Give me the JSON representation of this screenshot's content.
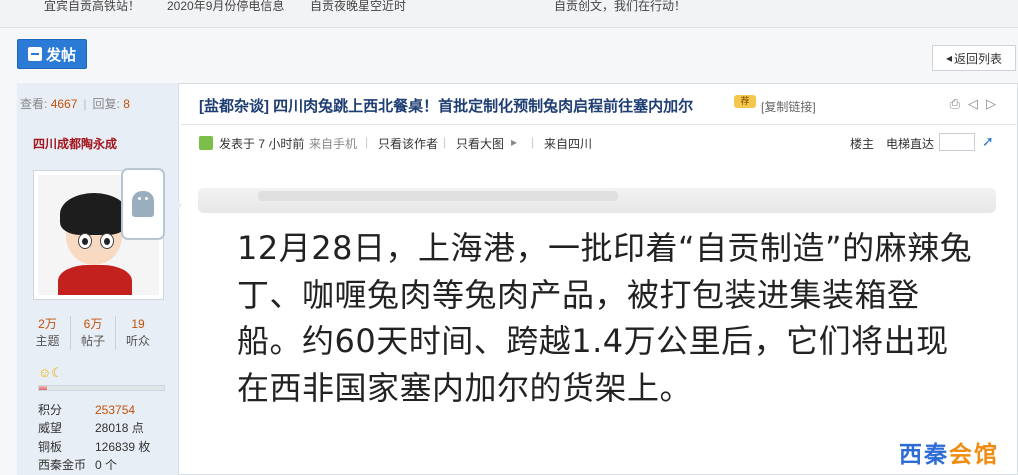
{
  "topbar": {
    "items": [
      "宜宾自贡高铁站！",
      "2020年9月份停电信息",
      "自贡夜晚星空近时",
      "自贡创文，我们在行动！"
    ]
  },
  "toolbar": {
    "post_label": "发帖",
    "back_label": "返回列表"
  },
  "thread_stats": {
    "views_label": "查看:",
    "views": "4667",
    "replies_label": "回复:",
    "replies": "8"
  },
  "thread": {
    "title": "[盐都杂谈] 四川肉兔跳上西北餐桌！首批定制化预制兔肉启程前往塞内加尔",
    "copy_link": "[复制链接]"
  },
  "author": {
    "name": "四川成都陶永成",
    "counts": [
      {
        "value": "2万",
        "label": "主题"
      },
      {
        "value": "6万",
        "label": "帖子"
      },
      {
        "value": "19",
        "label": "听众"
      }
    ],
    "level_progress": 0.06,
    "attributes": [
      {
        "label": "积分",
        "value": "253754",
        "highlight": true
      },
      {
        "label": "威望",
        "value": "28018 点",
        "highlight": false
      },
      {
        "label": "铜板",
        "value": "126839 枚",
        "highlight": false
      },
      {
        "label": "西秦金币",
        "value": "0 个",
        "highlight": false
      }
    ]
  },
  "post_meta": {
    "posted": "发表于 7 小时前",
    "source": "来自手机",
    "only_author": "只看该作者",
    "big_image": "只看大图",
    "from_region": "来自四川",
    "floor": "楼主",
    "elevator": "电梯直达"
  },
  "post_body": "12月28日，上海港，一批印着“自贡制造”的麻辣兔丁、咖喱兔肉等兔肉产品，被打包装进集装箱登船。约60天时间、跨越1.4万公里后，它们将出现在西非国家塞内加尔的货架上。",
  "watermark": {
    "part1": "西秦",
    "part2": "会馆"
  },
  "icons": [
    "pen-icon",
    "back-icon",
    "print-icon",
    "prev-icon",
    "next-icon",
    "android-icon",
    "sun-icon",
    "moon-icon",
    "jump-icon"
  ]
}
